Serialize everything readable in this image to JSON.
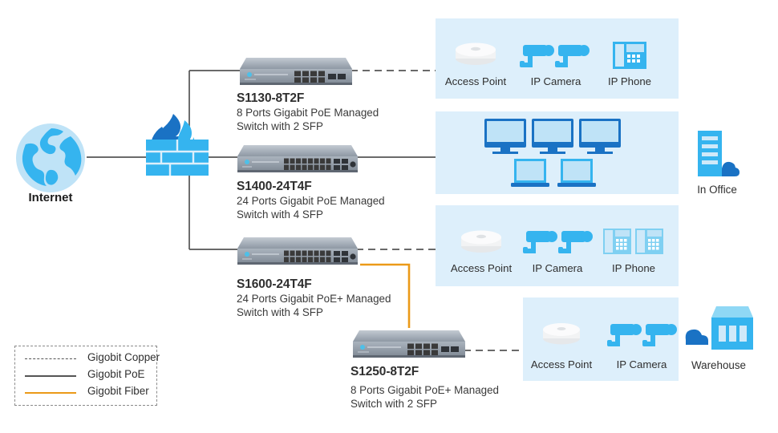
{
  "diagram": {
    "internet": {
      "label": "Internet",
      "icon": "globe-icon"
    },
    "firewall": {
      "icon": "firewall-flame-icon"
    },
    "switches": [
      {
        "id": "s1130",
        "title": "S1130-8T2F",
        "desc_line1": "8 Ports Gigabit PoE Managed",
        "desc_line2": "Switch with 2 SFP",
        "ports": 8,
        "icon": "network-switch-icon"
      },
      {
        "id": "s1400",
        "title": "S1400-24T4F",
        "desc_line1": "24 Ports Gigabit PoE Managed",
        "desc_line2": "Switch with 4 SFP",
        "ports": 24,
        "icon": "network-switch-icon"
      },
      {
        "id": "s1600",
        "title": "S1600-24T4F",
        "desc_line1": "24 Ports Gigabit PoE+ Managed",
        "desc_line2": "Switch with 4 SFP",
        "ports": 24,
        "icon": "network-switch-icon"
      },
      {
        "id": "s1250",
        "title": "S1250-8T2F",
        "desc_line1": "8 Ports Gigabit PoE+ Managed",
        "desc_line2": "Switch with 2 SFP",
        "ports": 8,
        "icon": "network-switch-icon"
      }
    ],
    "zones": [
      {
        "id": "zone-top",
        "devices": [
          {
            "label": "Access Point",
            "icon": "access-point-icon"
          },
          {
            "label": "IP Camera",
            "icon": "ip-camera-icon"
          },
          {
            "label": "IP Phone",
            "icon": "ip-phone-icon"
          }
        ]
      },
      {
        "id": "zone-office",
        "devices": [
          {
            "label": "",
            "icon": "desktop-monitor-icon"
          },
          {
            "label": "",
            "icon": "laptop-icon"
          }
        ]
      },
      {
        "id": "zone-middle",
        "devices": [
          {
            "label": "Access Point",
            "icon": "access-point-icon"
          },
          {
            "label": "IP Camera",
            "icon": "ip-camera-icon"
          },
          {
            "label": "IP Phone",
            "icon": "ip-phone-icon"
          }
        ]
      },
      {
        "id": "zone-warehouse",
        "devices": [
          {
            "label": "Access Point",
            "icon": "access-point-icon"
          },
          {
            "label": "IP Camera",
            "icon": "ip-camera-icon"
          }
        ]
      }
    ],
    "places": [
      {
        "id": "in-office",
        "label": "In Office",
        "icon": "office-building-icon"
      },
      {
        "id": "warehouse",
        "label": "Warehouse",
        "icon": "warehouse-building-icon"
      }
    ],
    "legend": {
      "items": [
        {
          "label": "Gigobit Copper",
          "style": "dashed",
          "color": "#555555"
        },
        {
          "label": "Gigobit PoE",
          "style": "solid",
          "color": "#555555"
        },
        {
          "label": "Gigobit Fiber",
          "style": "solid",
          "color": "#eb9a18"
        }
      ]
    },
    "colors": {
      "zone_background": "#ddeffb",
      "accent_blue": "#35b4ef",
      "deep_blue": "#1a72c4",
      "fiber_orange": "#eb9a18",
      "line_gray": "#555555",
      "switch_body": "#98a2ad"
    }
  }
}
